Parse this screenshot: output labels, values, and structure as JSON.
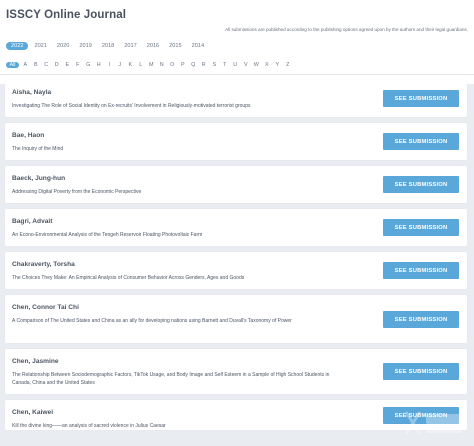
{
  "header": {
    "title": "ISSCY Online Journal",
    "notice": "All submissions are published according to the publishing options agreed upon by the authors and their legal guardians."
  },
  "years": [
    {
      "label": "2022",
      "active": true
    },
    {
      "label": "2021",
      "active": false
    },
    {
      "label": "2020",
      "active": false
    },
    {
      "label": "2019",
      "active": false
    },
    {
      "label": "2018",
      "active": false
    },
    {
      "label": "2017",
      "active": false
    },
    {
      "label": "2016",
      "active": false
    },
    {
      "label": "2015",
      "active": false
    },
    {
      "label": "2014",
      "active": false
    }
  ],
  "letters": [
    "All",
    "A",
    "B",
    "C",
    "D",
    "E",
    "F",
    "G",
    "H",
    "I",
    "J",
    "K",
    "L",
    "M",
    "N",
    "O",
    "P",
    "Q",
    "R",
    "S",
    "T",
    "U",
    "V",
    "W",
    "X",
    "Y",
    "Z"
  ],
  "active_letter": "All",
  "button_label": "SEE SUBMISSION",
  "submissions": [
    {
      "author": "Aisha, Nayla",
      "title": "Investigating The Role of Social Identity on Ex-recruits' Involvement in Religiously-motivated terrorist groups"
    },
    {
      "author": "Bae, Haon",
      "title": "The Inquiry of the Mind"
    },
    {
      "author": "Baeck, Jung-hun",
      "title": "Addressing Digital Poverty from the Economic Perspective"
    },
    {
      "author": "Bagri, Advait",
      "title": "An Econo-Environmental Analysis of the Tengeh Reservoir Floating Photovoltaic Farm"
    },
    {
      "author": "Chakraverty, Torsha",
      "title": "The Choices They Make: An Empirical Analysis of Consumer Behavior Across Genders, Ages and Goods"
    },
    {
      "author": "Chen, Connor Tai Chi",
      "title": "A Comparison of The United States and China as an ally for developing nations using Barnett and Duvall's Taxonomy of Power"
    },
    {
      "author": "Chen, Jasmine",
      "title": "The Relationship Between Sociodemographic Factors, TikTok Usage, and Body Image and Self Esteem in a Sample of High School Students in Canada, China and the United States"
    },
    {
      "author": "Chen, Kaiwei",
      "title": "Kill the divine king——an analysis of sacred violence in Julius Caesar"
    }
  ],
  "colors": {
    "accent": "#5aa7d9",
    "background": "#e9ecf1",
    "card": "#ffffff",
    "text": "#4b5563"
  }
}
